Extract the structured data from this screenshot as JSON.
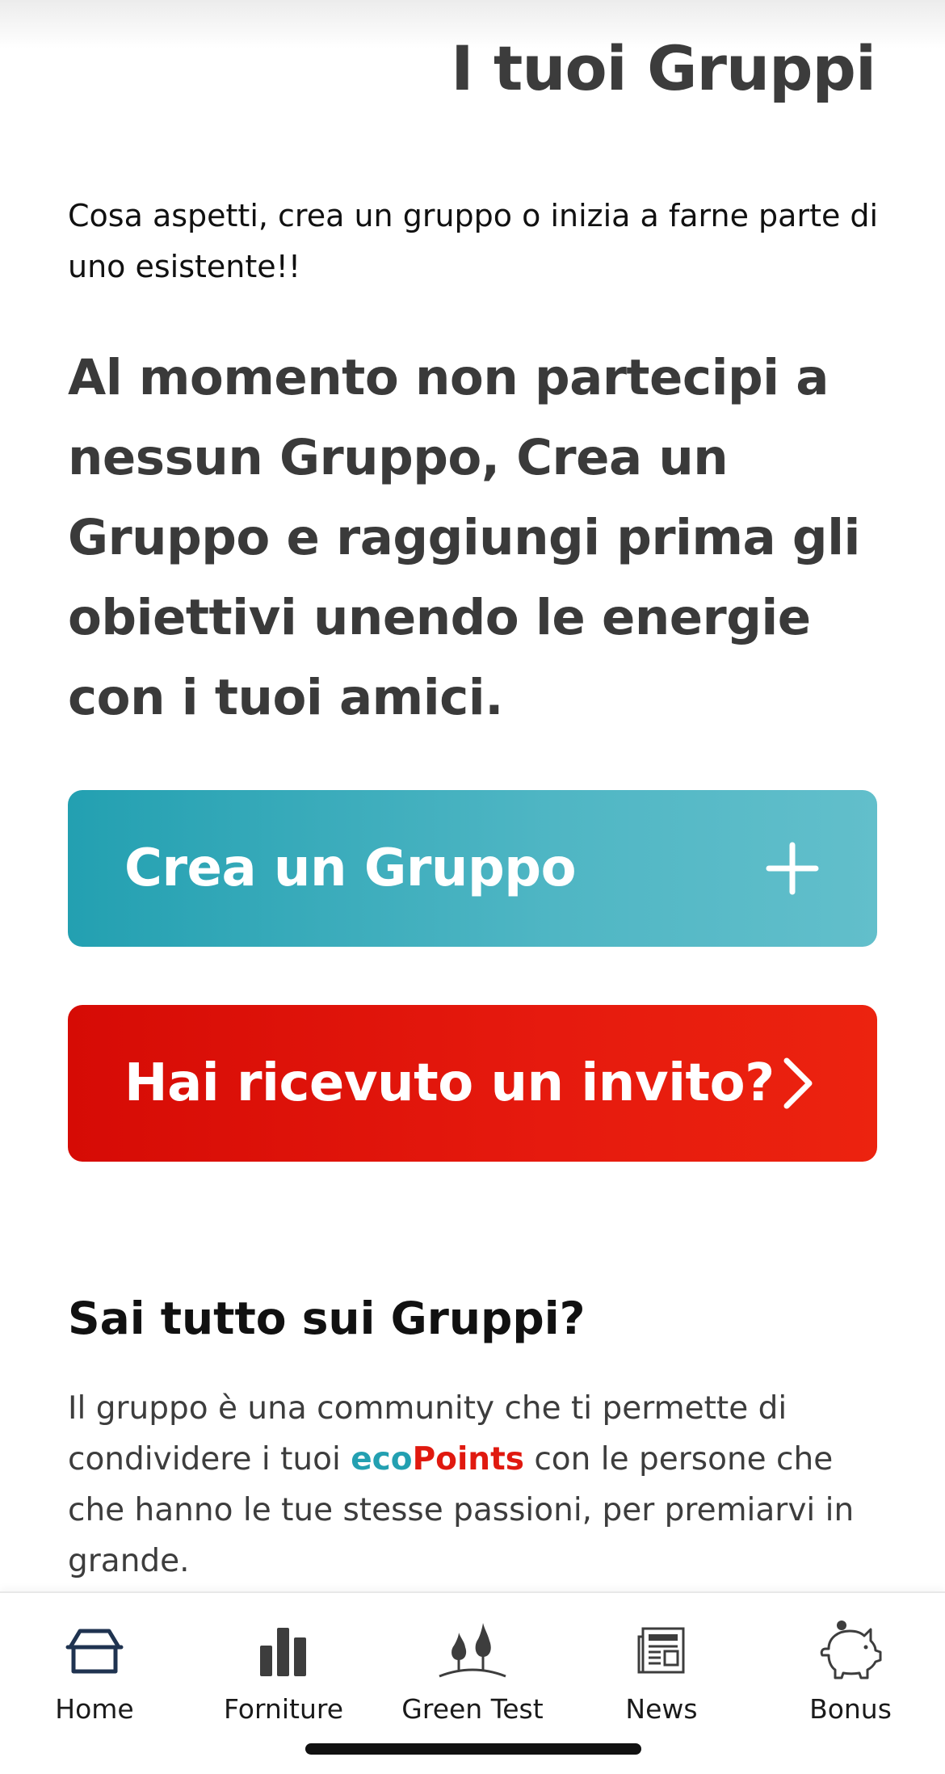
{
  "header": {
    "title": "I tuoi Gruppi"
  },
  "intro": {
    "subtitle": "Cosa aspetti, crea un gruppo o inizia a farne parte di uno esistente!!",
    "empty_message": "Al momento non partecipi a nessun Gruppo, Crea un Gruppo e raggiungi prima gli obiettivi unendo le energie con i tuoi amici."
  },
  "actions": {
    "create_label": "Crea un Gruppo",
    "create_icon": "plus-icon",
    "invite_label": "Hai ricevuto un invito?",
    "invite_icon": "chevron-right-icon"
  },
  "info": {
    "title": "Sai tutto sui Gruppi?",
    "text_before": "Il gruppo è una community che ti permette di condividere i tuoi ",
    "brand_part1": "eco",
    "brand_part2": "Points",
    "text_after": " con le persone che che hanno le tue stesse passioni, per premiarvi in grande."
  },
  "tabbar": {
    "items": [
      {
        "label": "Home",
        "icon": "home-icon"
      },
      {
        "label": "Forniture",
        "icon": "bar-chart-icon"
      },
      {
        "label": "Green Test",
        "icon": "trees-icon"
      },
      {
        "label": "News",
        "icon": "newspaper-icon"
      },
      {
        "label": "Bonus",
        "icon": "piggy-bank-icon"
      }
    ]
  },
  "colors": {
    "teal": "#23a0b1",
    "red": "#e0190f",
    "dark_text": "#3a3a3a"
  }
}
